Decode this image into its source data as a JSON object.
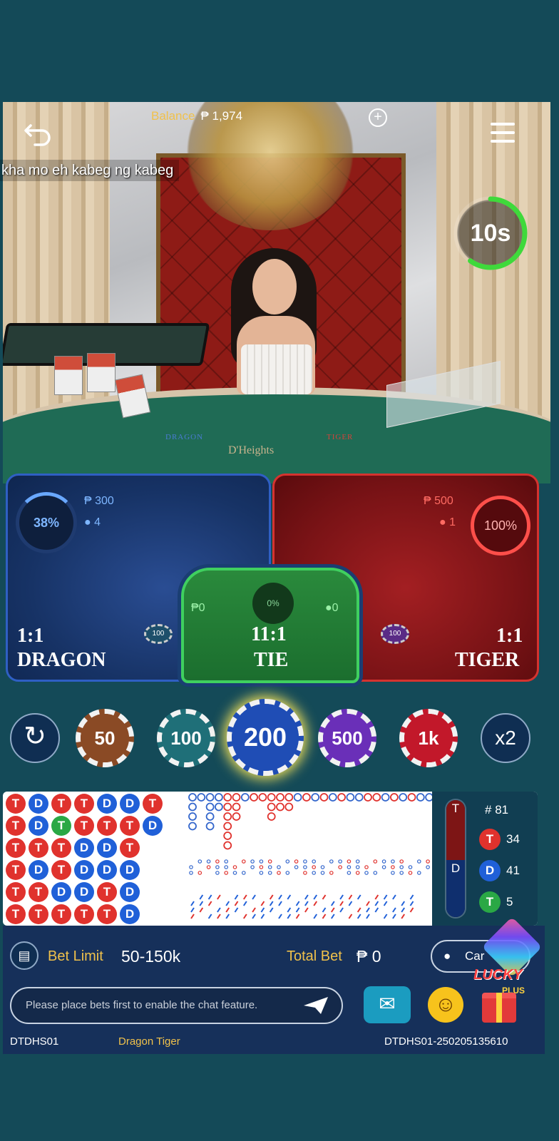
{
  "header": {
    "balance_label": "Balance",
    "balance_value": "₱ 1,974",
    "marquee": "kha mo eh kabeg ng kabeg",
    "timer": "10s",
    "timer_fraction": 0.6
  },
  "table_labels": {
    "dragon": "DRAGON",
    "tiger": "TIGER",
    "brand": "D'Heights"
  },
  "bets": {
    "dragon": {
      "percent": "38%",
      "amount": "₱ 300",
      "players": "4",
      "odds": "1:1",
      "name": "DRAGON",
      "chip": "100"
    },
    "tiger": {
      "percent": "100%",
      "amount": "₱ 500",
      "players": "1",
      "odds": "1:1",
      "name": "TIGER",
      "chip": "100"
    },
    "tie": {
      "percent": "0%",
      "amount": "₱0",
      "players": "0",
      "odds": "11:1",
      "name": "TIE"
    }
  },
  "chips": [
    {
      "label": "50",
      "color": "#8a4a25"
    },
    {
      "label": "100",
      "color": "#1f6f78"
    },
    {
      "label": "200",
      "color": "#1f4db5",
      "selected": true
    },
    {
      "label": "500",
      "color": "#6a2fb8"
    },
    {
      "label": "1k",
      "color": "#c2182a"
    }
  ],
  "multiplier": "x2",
  "bead_road": [
    [
      "T",
      "T",
      "T",
      "T",
      "T",
      "T"
    ],
    [
      "D",
      "D",
      "T",
      "D",
      "T",
      "T"
    ],
    [
      "T",
      "G",
      "T",
      "T",
      "D",
      "T"
    ],
    [
      "T",
      "T",
      "D",
      "D",
      "D",
      "T"
    ],
    [
      "D",
      "T",
      "D",
      "D",
      "T",
      "T"
    ],
    [
      "D",
      "T",
      "T",
      "D",
      "D",
      "D"
    ],
    [
      "T",
      "D",
      "",
      "",
      "",
      ""
    ]
  ],
  "legend": {
    "round_label": "#",
    "round": "81",
    "tiger_letter": "T",
    "tiger_count": "34",
    "dragon_letter": "D",
    "dragon_count": "41",
    "tie_letter": "T",
    "tie_count": "5",
    "side_t": "T",
    "side_d": "D"
  },
  "footer_bar": {
    "bet_limit_label": "Bet Limit",
    "bet_limit_value": "50-150k",
    "total_bet_label": "Total Bet",
    "total_bet_value": "₱ 0",
    "cancel_label": "Car",
    "chat_placeholder": "Please place bets first to enable the chat feature.",
    "lucky": "LUCKY",
    "plus": "PLUS",
    "table_code": "DTDHS01",
    "game_name": "Dragon Tiger",
    "round_id": "DTDHS01-250205135610"
  }
}
